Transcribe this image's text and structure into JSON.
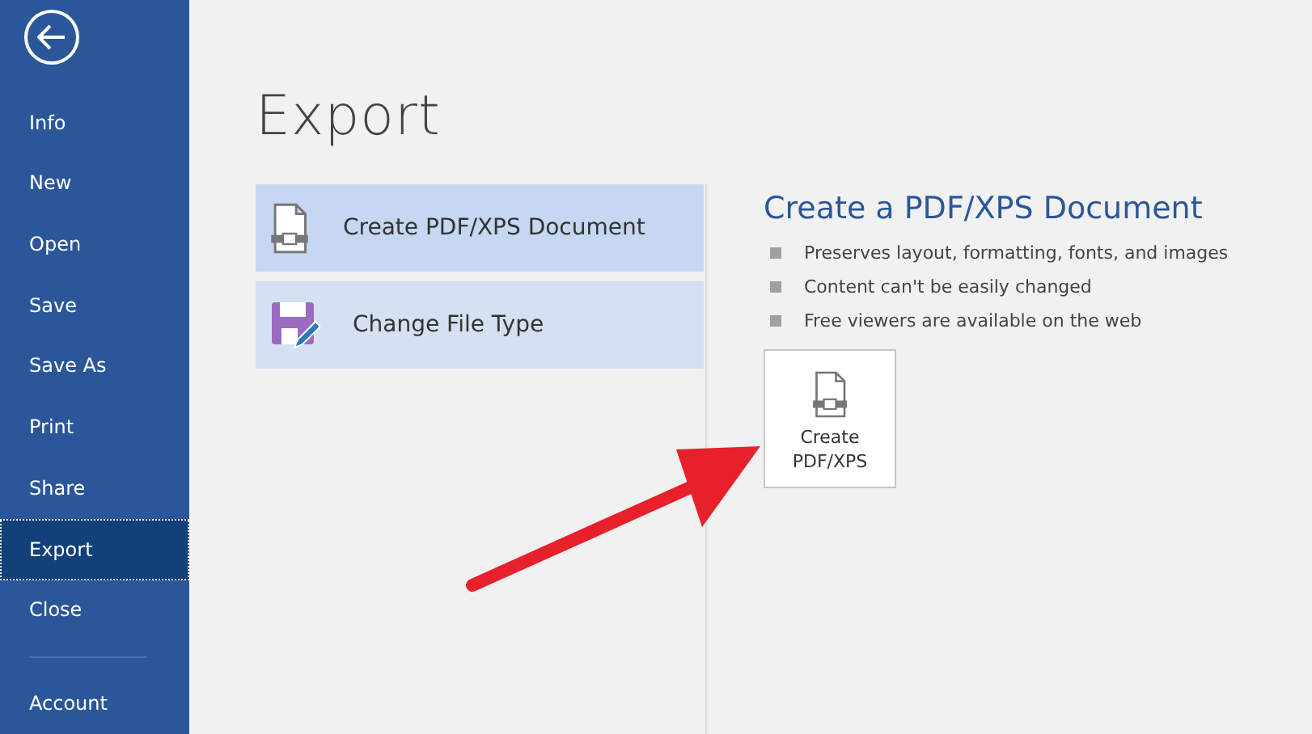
{
  "sidebar": {
    "items": [
      {
        "label": "Info",
        "selected": false
      },
      {
        "label": "New",
        "selected": false
      },
      {
        "label": "Open",
        "selected": false
      },
      {
        "label": "Save",
        "selected": false
      },
      {
        "label": "Save As",
        "selected": false
      },
      {
        "label": "Print",
        "selected": false
      },
      {
        "label": "Share",
        "selected": false
      },
      {
        "label": "Export",
        "selected": true
      },
      {
        "label": "Close",
        "selected": false
      }
    ],
    "footer_items": [
      {
        "label": "Account",
        "selected": false
      }
    ]
  },
  "title": "Export",
  "options": [
    {
      "kind": "pdf",
      "label": "Create PDF/XPS Document",
      "selected": true
    },
    {
      "kind": "filetype",
      "label": "Change File Type",
      "selected": false
    }
  ],
  "detail": {
    "heading": "Create a PDF/XPS Document",
    "bullets": [
      "Preserves layout, formatting, fonts, and images",
      "Content can't be easily changed",
      "Free viewers are available on the web"
    ],
    "button": "Create\nPDF/XPS"
  }
}
